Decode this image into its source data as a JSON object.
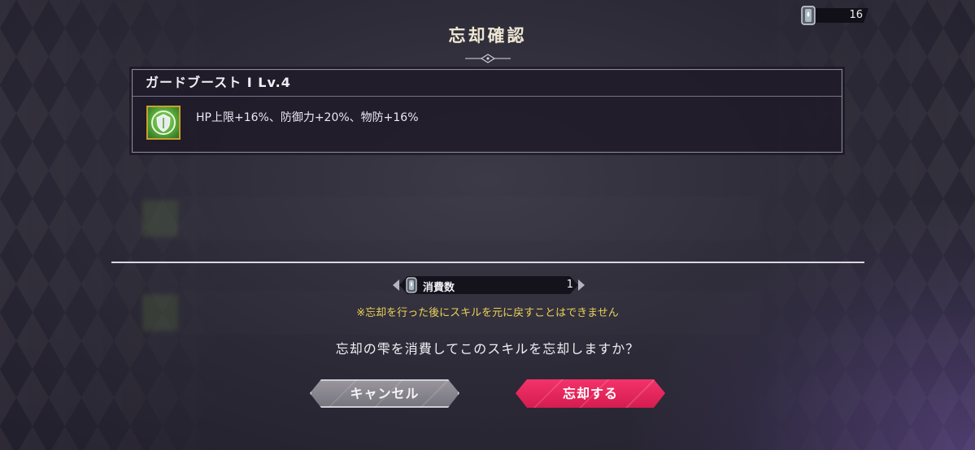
{
  "header": {
    "title": "忘却確認",
    "drop_count": "16"
  },
  "skill": {
    "name": "ガードブースト I  Lv.4",
    "description": "HP上限+16%、防御力+20%、物防+16%",
    "icon": "skill-shield-icon"
  },
  "cost": {
    "label": "消費数",
    "value": "1",
    "icon": "forget-drop-icon"
  },
  "warning": "※忘却を行った後にスキルを元に戻すことはできません",
  "question": "忘却の雫を消費してこのスキルを忘却しますか？",
  "buttons": {
    "cancel_label": "キャンセル",
    "confirm_label": "忘却する"
  },
  "colors": {
    "confirm": "#e8285c",
    "cancel": "#8a878f",
    "warning": "#e9d15a",
    "icon_frame": "#c9a22b"
  }
}
